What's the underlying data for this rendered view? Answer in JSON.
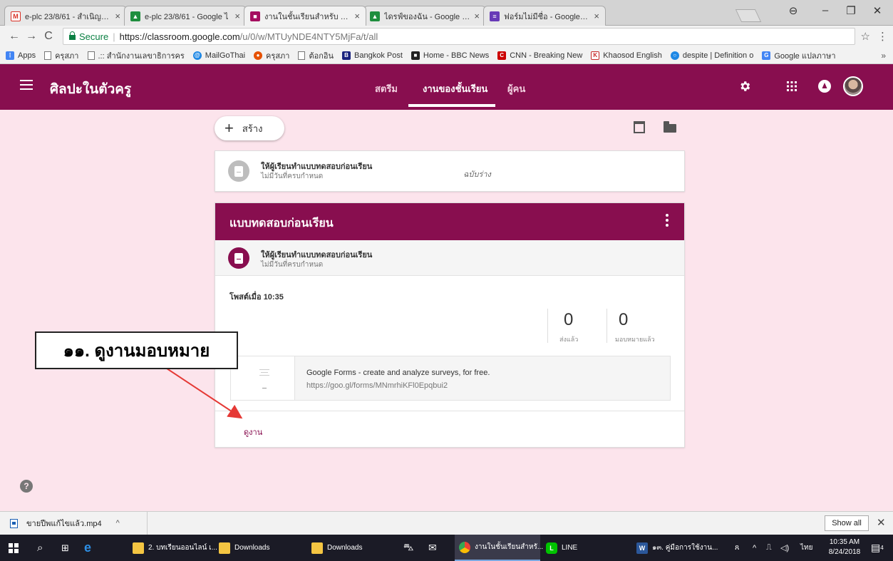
{
  "browser": {
    "tabs": [
      {
        "title": "e-plc 23/8/61 - สำเนิญให้ผ่",
        "favicon": "gmail",
        "color": "#d93025"
      },
      {
        "title": "e-plc 23/8/61 - Google ไ",
        "favicon": "drive",
        "color": "#1e8e3e"
      },
      {
        "title": "งานในชั้นเรียนสำหรับ ศิลปะใน",
        "favicon": "classroom",
        "color": "#a50e5f"
      },
      {
        "title": "ไดรฟ์ของฉัน - Google ไดรฟ์",
        "favicon": "drive",
        "color": "#1e8e3e"
      },
      {
        "title": "ฟอร์มไม่มีชื่อ - Google ฟอร์ม",
        "favicon": "forms",
        "color": "#673ab7"
      }
    ],
    "secure_label": "Secure",
    "url_host": "https://classroom.google.com",
    "url_path": "/u/0/w/MTUyNDE4NTY5MjFa/t/all",
    "bookmarks": [
      {
        "label": "Apps",
        "icon": "apps-grid-icon"
      },
      {
        "label": "ครุสภา",
        "icon": "page-icon"
      },
      {
        "label": ".:: สำนักงานเลขาธิการคร",
        "icon": "page-icon"
      },
      {
        "label": "MailGoThai",
        "icon": "mailgothai-icon"
      },
      {
        "label": "ครุสภา",
        "icon": "ksp-icon"
      },
      {
        "label": "ต้อกอิน",
        "icon": "page-icon"
      },
      {
        "label": "Bangkok Post",
        "icon": "bangkokpost-icon"
      },
      {
        "label": "Home - BBC News",
        "icon": "bbc-icon"
      },
      {
        "label": "CNN - Breaking New",
        "icon": "cnn-icon"
      },
      {
        "label": "Khaosod English",
        "icon": "khaosod-icon"
      },
      {
        "label": "despite | Definition o",
        "icon": "dictionary-icon"
      },
      {
        "label": "Google แปลภาษา",
        "icon": "translate-icon"
      }
    ]
  },
  "classroom": {
    "course_title": "ศิลปะในตัวครู",
    "nav_tabs": [
      {
        "label": "สตรีม"
      },
      {
        "label": "งานของชั้นเรียน"
      },
      {
        "label": "ผู้คน"
      }
    ],
    "create_label": "สร้าง",
    "draft_item": {
      "title": "ให้ผู้เรียนทำแบบทดสอบก่อนเรียน",
      "due": "ไม่มีวันที่ครบกำหนด",
      "status": "ฉบับร่าง"
    },
    "topic": {
      "title": "แบบทดสอบก่อนเรียน",
      "assignment_title": "ให้ผู้เรียนทำแบบทดสอบก่อนเรียน",
      "assignment_due": "ไม่มีวันที่ครบกำหนด",
      "posted": "โพสต์เมื่อ 10:35",
      "turned_in_count": "0",
      "turned_in_label": "ส่งแล้ว",
      "assigned_count": "0",
      "assigned_label": "มอบหมายแล้ว",
      "attachment_title": "Google Forms - create and analyze surveys, for free.",
      "attachment_url": "https://goo.gl/forms/MNmrhiKFl0Epqbui2",
      "view_link": "ดูงาน"
    },
    "accent_color": "#880e4f",
    "background_color": "#fce4ec"
  },
  "annotation": {
    "callout_text": "๑๑. ดูงานมอบหมาย",
    "arrow_color": "#e53935"
  },
  "downloads": {
    "file_name": "ขายปีพแก้ไขแล้ว.mp4",
    "show_all_label": "Show all"
  },
  "taskbar": {
    "items": [
      {
        "label": "2. บทเรียนออนไลน์ เ...",
        "icon": "folder-icon"
      },
      {
        "label": "Downloads",
        "icon": "folder-icon"
      },
      {
        "label": "Downloads",
        "icon": "folder-icon"
      },
      {
        "label": "งานในชั้นเรียนสำหรั...",
        "icon": "chrome-icon"
      },
      {
        "label": "LINE",
        "icon": "line-icon"
      },
      {
        "label": "๑๓. คู่มือการใช้งาน...",
        "icon": "word-icon"
      }
    ],
    "language": "ไทย",
    "time": "10:35 AM",
    "date": "8/24/2018",
    "notification_count": "4"
  }
}
